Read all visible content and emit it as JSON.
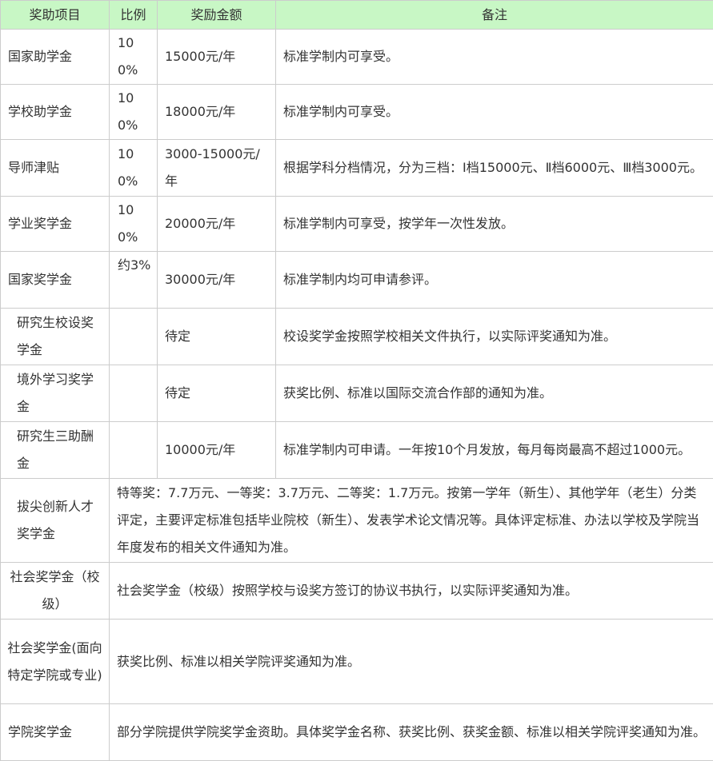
{
  "headers": [
    "奖助项目",
    "比例",
    "奖励金额",
    "备注"
  ],
  "rows": [
    {
      "name": "国家助学金",
      "ratio": "100%",
      "amount": "15000元/年",
      "note": "标准学制内可享受。"
    },
    {
      "name": "学校助学金",
      "ratio": "100%",
      "amount": "18000元/年",
      "note": "标准学制内可享受。"
    },
    {
      "name": "导师津贴",
      "ratio": "100%",
      "amount": "3000-15000元/年",
      "note": "根据学科分档情况，分为三档：Ⅰ档15000元、Ⅱ档6000元、Ⅲ档3000元。"
    },
    {
      "name": "学业奖学金",
      "ratio": "100%",
      "amount": "20000元/年",
      "note": "标准学制内可享受，按学年一次性发放。"
    },
    {
      "name": "国家奖学金",
      "ratio": "约3%",
      "amount": "30000元/年",
      "note": "标准学制内均可申请参评。"
    },
    {
      "name": "研究生校设奖学金",
      "ratio": "",
      "amount": "待定",
      "note": "校设奖学金按照学校相关文件执行，以实际评奖通知为准。"
    },
    {
      "name": "境外学习奖学金",
      "ratio": "",
      "amount": "待定",
      "note": "获奖比例、标准以国际交流合作部的通知为准。"
    },
    {
      "name": "研究生三助酬金",
      "ratio": "",
      "amount": "10000元/年",
      "note": "标准学制内可申请。一年按10个月发放，每月每岗最高不超过1000元。"
    }
  ],
  "span_rows": [
    {
      "name": "拔尖创新人才奖学金",
      "note": "特等奖：7.7万元、一等奖：3.7万元、二等奖：1.7万元。按第一学年（新生）、其他学年（老生）分类评定，主要评定标准包括毕业院校（新生）、发表学术论文情况等。具体评定标准、办法以学校及学院当年度发布的相关文件通知为准。"
    },
    {
      "name": "社会奖学金（校级）",
      "note": "社会奖学金（校级）按照学校与设奖方签订的协议书执行，以实际评奖通知为准。"
    },
    {
      "name": "社会奖学金(面向特定学院或专业)",
      "note": "获奖比例、标准以相关学院评奖通知为准。"
    },
    {
      "name": "学院奖学金",
      "note": "部分学院提供学院奖学金资助。具体奖学金名称、获奖比例、获奖金额、标准以相关学院评奖通知为准。"
    }
  ]
}
